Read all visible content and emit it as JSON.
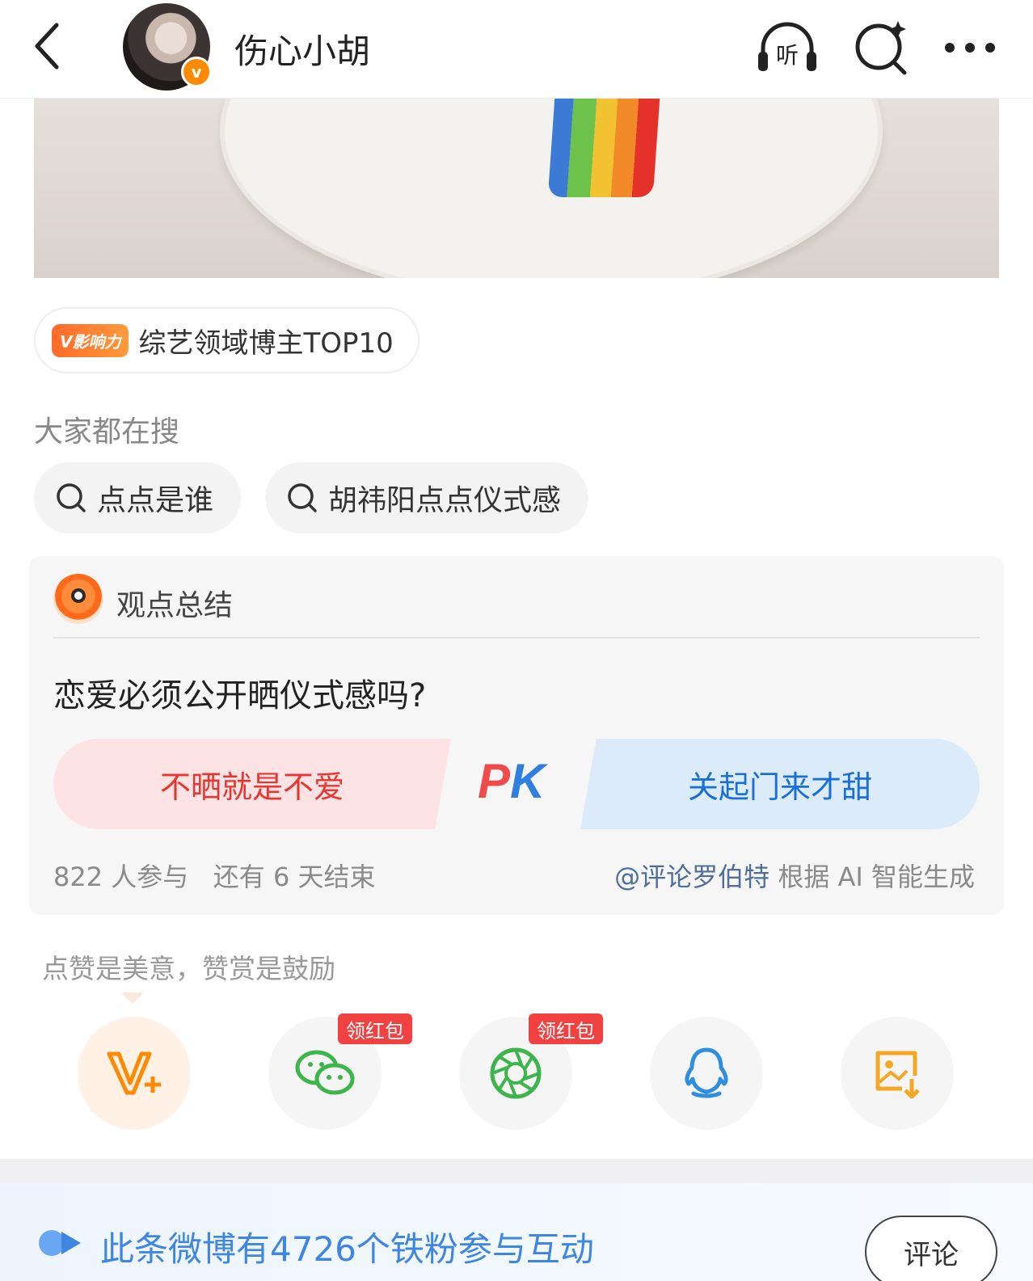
{
  "header": {
    "username": "伤心小胡",
    "verified_badge": "v",
    "listen_label": "听",
    "icons": [
      "back-icon",
      "listen-icon",
      "search-icon",
      "more-icon"
    ]
  },
  "influence_chip": {
    "tag": "V影响力",
    "text": "综艺领域博主TOP10"
  },
  "trending": {
    "label": "大家都在搜",
    "items": [
      "点点是谁",
      "胡祎阳点点仪式感"
    ]
  },
  "opinion": {
    "title": "观点总结",
    "question": "恋爱必须公开晒仪式感吗?",
    "option_a": "不晒就是不爱",
    "pk_p": "P",
    "pk_k": "K",
    "option_b": "关起门来才甜",
    "participants": "822 人参与",
    "remaining": "还有 6 天结束",
    "credit_at": "@评论罗伯特",
    "credit_note": "根据 AI 智能生成"
  },
  "praise_text": "点赞是美意，赞赏是鼓励",
  "share": {
    "redpack_label": "领红包",
    "redpack_label_2": "领红包",
    "icons": [
      "reward-icon",
      "wechat-icon",
      "moments-icon",
      "qq-icon",
      "save-image-icon"
    ]
  },
  "bottom_bar": {
    "text": "此条微博有4726个铁粉参与互动",
    "comment_button": "评论"
  },
  "colors": {
    "accent_orange": "#ff8a00",
    "red": "#e8352f",
    "blue": "#1a6fd6",
    "wechat_green": "#3cb54a",
    "qq_blue": "#2e8fe0"
  }
}
